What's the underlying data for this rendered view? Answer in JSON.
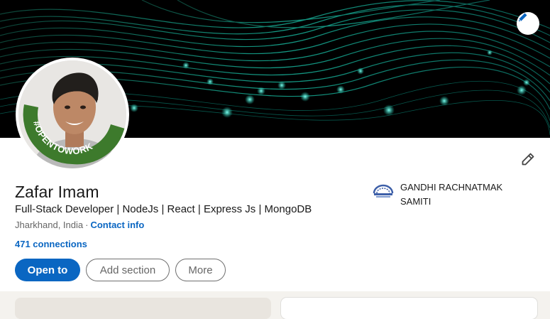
{
  "profile": {
    "name": "Zafar Imam",
    "headline": "Full-Stack Developer | NodeJs | React | Express Js | MongoDB",
    "location": "Jharkhand, India",
    "separator": "·",
    "contact_link": "Contact info",
    "connections": "471 connections",
    "open_to_work_frame": "#OPENTOWORK"
  },
  "organization": {
    "name": "GANDHI RACHNATMAK SAMITI"
  },
  "actions": {
    "open_to": "Open to",
    "add_section": "Add section",
    "more": "More"
  },
  "icons": {
    "banner_edit": "pencil-icon",
    "profile_edit": "pencil-icon",
    "org_logo": "organization-logo"
  },
  "colors": {
    "accent": "#0a66c2",
    "open_to_work_green": "#2e7d32",
    "banner_bg": "#000000",
    "banner_glow": "#19c9b0"
  }
}
